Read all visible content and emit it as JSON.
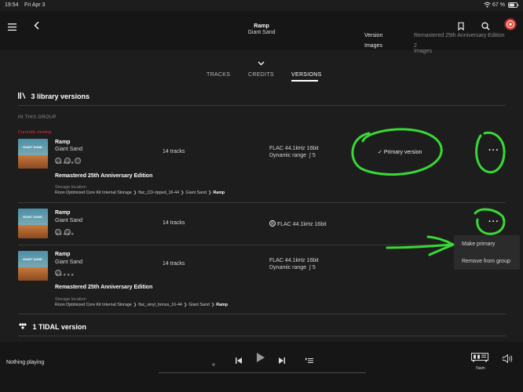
{
  "status_bar": {
    "time": "19:54",
    "date": "Fri Apr 3",
    "battery": "67 %"
  },
  "header": {
    "album": "Ramp",
    "artist": "Giant Sand",
    "meta": [
      {
        "label": "Version",
        "value": "Remastered 25th Anniversary Edition"
      },
      {
        "label": "Images",
        "value": "2 Images"
      }
    ]
  },
  "tabs": [
    {
      "label": "TRACKS",
      "active": false
    },
    {
      "label": "CREDITS",
      "active": false
    },
    {
      "label": "VERSIONS",
      "active": true
    }
  ],
  "library_heading": "3 library versions",
  "group_label": "IN THIS GROUP",
  "currently_viewing": "Currently viewing",
  "versions": [
    {
      "cover_text": "GIANT SAND",
      "title": "Ramp",
      "artist": "Giant Sand",
      "tracks": "14 tracks",
      "format": "FLAC 44.1kHz 16bit",
      "dynamic_range": "Dynamic range",
      "dr_value": "5",
      "edition": "Remastered 25th Anniversary Edition",
      "storage_label": "Storage location",
      "path": [
        "Roon Optimized Core Kit Internal Storage",
        "flac_CD-ripped_16-44",
        "Giant Sand",
        "Ramp"
      ],
      "primary": "Primary version",
      "stars": "★★★★★"
    },
    {
      "cover_text": "GIANT SAND",
      "title": "Ramp",
      "artist": "Giant Sand",
      "tracks": "14 tracks",
      "format": "FLAC 44.1kHz 16bit",
      "stars": "★★★★★"
    },
    {
      "cover_text": "GIANT SAND",
      "title": "Ramp",
      "artist": "Giant Sand",
      "tracks": "14 tracks",
      "format": "FLAC 44.1kHz 16bit",
      "dynamic_range": "Dynamic range",
      "dr_value": "5",
      "edition": "Remastered 25th Anniversary Edition",
      "storage_label": "Storage location",
      "path": [
        "Roon Optimized Core Kit Internal Storage",
        "flac_vinyl_bonus_16-44",
        "Giant Sand",
        "Ramp"
      ],
      "stars": "★★★★★"
    }
  ],
  "context_menu": {
    "items": [
      "Make primary",
      "Remove from group"
    ]
  },
  "tidal_heading": "1 TIDAL version",
  "player": {
    "status": "Nothing playing",
    "zone": "Naim",
    "progress": 0
  },
  "colors": {
    "accent": "#38d936",
    "currently_viewing": "#e0303a",
    "background": "#1d1d1d"
  }
}
